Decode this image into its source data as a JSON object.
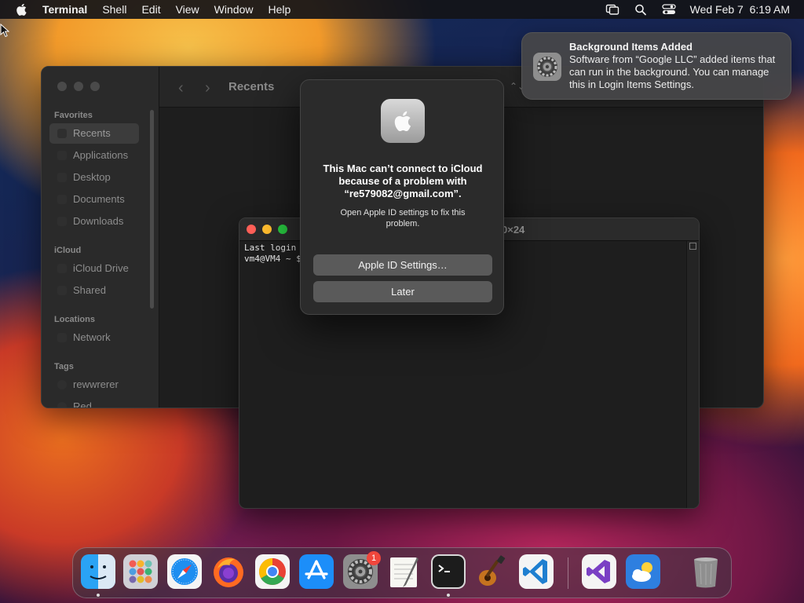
{
  "menubar": {
    "app_name": "Terminal",
    "items": [
      "Shell",
      "Edit",
      "View",
      "Window",
      "Help"
    ],
    "datetime": "Wed Feb 7  6:19 AM",
    "status_icons": [
      "screen-mirroring-icon",
      "search-icon",
      "control-center-icon"
    ]
  },
  "finder": {
    "title": "Recents",
    "sections": {
      "favorites": "Favorites",
      "icloud": "iCloud",
      "locations": "Locations",
      "tags": "Tags"
    },
    "favorites": [
      "Recents",
      "Applications",
      "Desktop",
      "Documents",
      "Downloads"
    ],
    "icloud": [
      "iCloud Drive",
      "Shared"
    ],
    "locations": [
      "Network"
    ],
    "tags": [
      "rewwrerer",
      "Red"
    ]
  },
  "terminal": {
    "title_fragment": "0×24",
    "line1": "Last login",
    "line2": "vm4@VM4 ~ $"
  },
  "dialog": {
    "message": "This Mac can’t connect to iCloud because of a problem with “re579082@gmail.com”.",
    "sub": "Open Apple ID settings to fix this problem.",
    "primary_button": "Apple ID Settings…",
    "secondary_button": "Later"
  },
  "notification": {
    "title": "Background Items Added",
    "body": "Software from “Google LLC” added items that can run in the background. You can manage this in Login Items Settings."
  },
  "dock": {
    "apps": [
      "Finder",
      "Launchpad",
      "Safari",
      "Firefox",
      "Chrome",
      "App Store",
      "System Settings",
      "TextEdit",
      "Terminal",
      "GarageBand",
      "Visual Studio Code",
      "Visual Studio",
      "Weather",
      "Trash"
    ],
    "settings_badge": "1"
  },
  "colors": {
    "close": "#ff5f57",
    "minimize": "#febc2e",
    "zoom": "#28c840",
    "badge": "#f0463c"
  }
}
